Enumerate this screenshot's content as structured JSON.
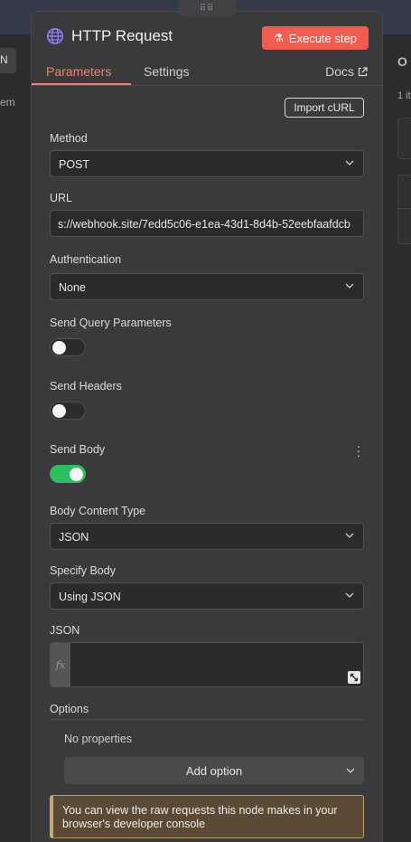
{
  "background": {
    "left_tab_label": "N",
    "left_text": "em",
    "right_heading": "O",
    "right_count": "1 it"
  },
  "header": {
    "title": "HTTP Request",
    "execute_label": "Execute step",
    "tabs": [
      {
        "label": "Parameters",
        "active": true
      },
      {
        "label": "Settings",
        "active": false
      }
    ],
    "docs_label": "Docs"
  },
  "params": {
    "import_curl_label": "Import cURL",
    "method": {
      "label": "Method",
      "value": "POST"
    },
    "url": {
      "label": "URL",
      "value": "s://webhook.site/7edd5c06-e1ea-43d1-8d4b-52eebfaafdcb"
    },
    "authentication": {
      "label": "Authentication",
      "value": "None"
    },
    "send_query": {
      "label": "Send Query Parameters",
      "enabled": false
    },
    "send_headers": {
      "label": "Send Headers",
      "enabled": false
    },
    "send_body": {
      "label": "Send Body",
      "enabled": true
    },
    "body_content_type": {
      "label": "Body Content Type",
      "value": "JSON"
    },
    "specify_body": {
      "label": "Specify Body",
      "value": "Using JSON"
    },
    "json": {
      "label": "JSON",
      "value": "",
      "fx": "fx"
    },
    "options": {
      "label": "Options",
      "empty_text": "No properties",
      "add_label": "Add option"
    },
    "notice": "You can view the raw requests this node makes in your browser's developer console"
  },
  "colors": {
    "accent": "#f47f6c",
    "execute": "#f05c4d",
    "toggle_on": "#2dbf5f",
    "panel": "#3a3a3c"
  }
}
